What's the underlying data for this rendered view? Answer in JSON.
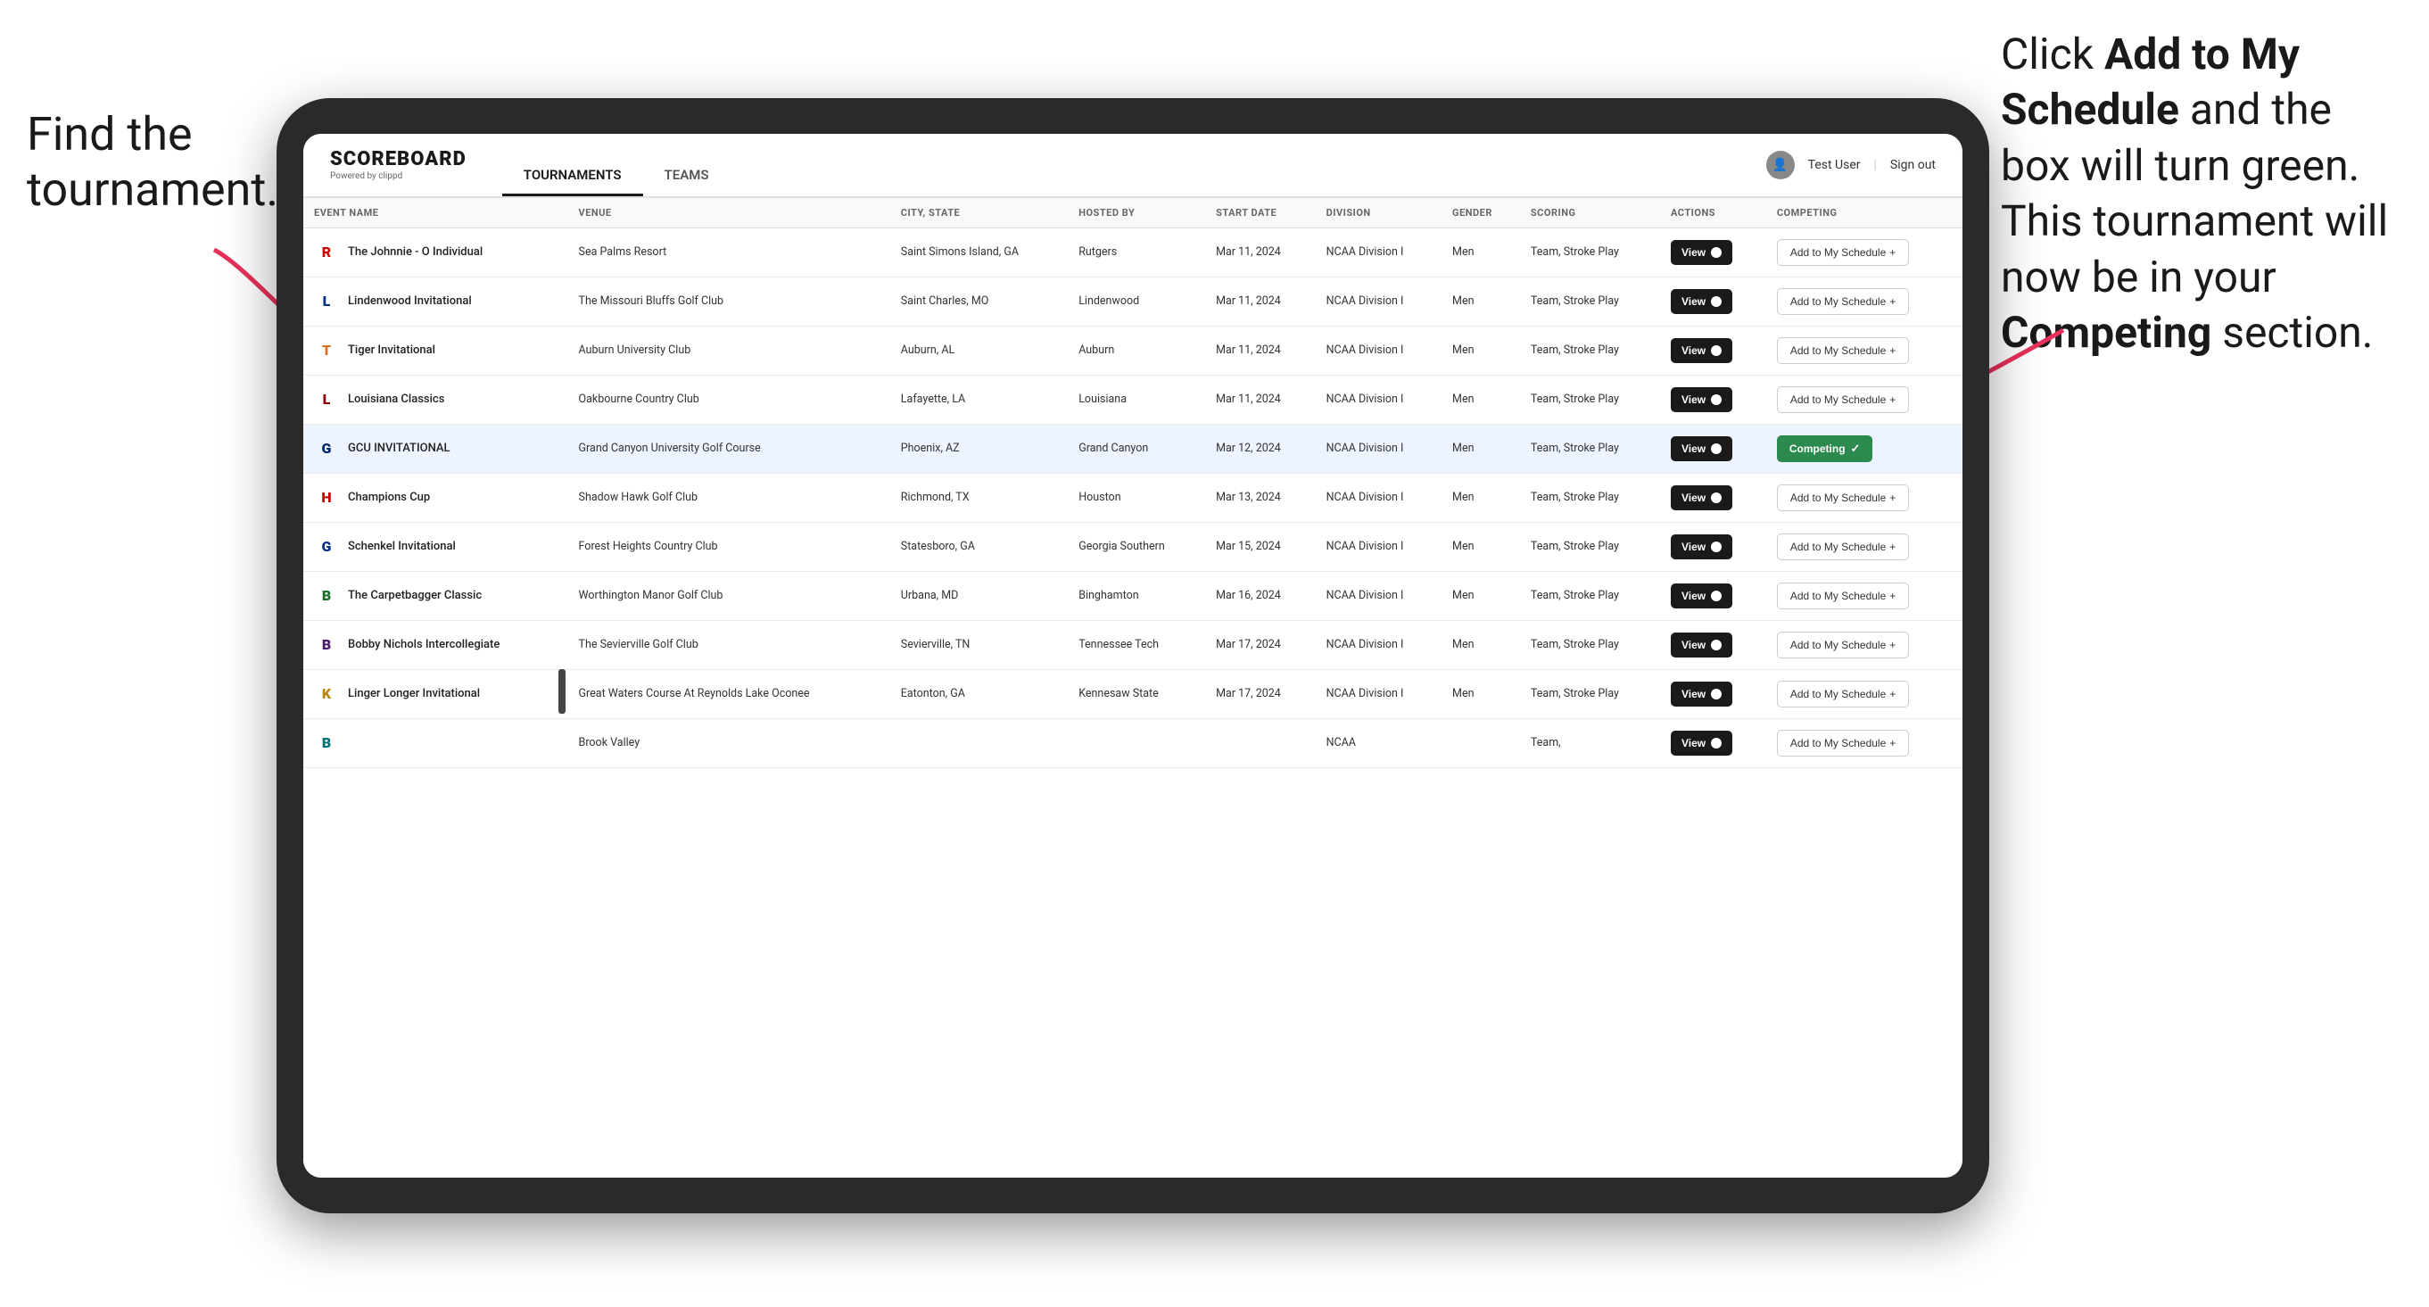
{
  "page": {
    "title": "Scoreboard App - Tournaments"
  },
  "annotation_left": {
    "text": "Find the tournament."
  },
  "annotation_right": {
    "line1": "Click ",
    "bold1": "Add to My Schedule",
    "line2": " and the box will turn green. This tournament will now be in your ",
    "bold2": "Competing",
    "line3": " section."
  },
  "header": {
    "logo": "SCOREBOARD",
    "logo_sub": "Powered by clippd",
    "nav": [
      {
        "label": "TOURNAMENTS",
        "active": true
      },
      {
        "label": "TEAMS",
        "active": false
      }
    ],
    "user_icon": "👤",
    "user_name": "Test User",
    "sign_out": "Sign out"
  },
  "table": {
    "columns": [
      {
        "id": "event_name",
        "label": "EVENT NAME"
      },
      {
        "id": "venue",
        "label": "VENUE"
      },
      {
        "id": "city_state",
        "label": "CITY, STATE"
      },
      {
        "id": "hosted_by",
        "label": "HOSTED BY"
      },
      {
        "id": "start_date",
        "label": "START DATE"
      },
      {
        "id": "division",
        "label": "DIVISION"
      },
      {
        "id": "gender",
        "label": "GENDER"
      },
      {
        "id": "scoring",
        "label": "SCORING"
      },
      {
        "id": "actions",
        "label": "ACTIONS"
      },
      {
        "id": "competing",
        "label": "COMPETING"
      }
    ],
    "rows": [
      {
        "id": 1,
        "logo": "R",
        "logo_color": "logo-red",
        "event_name": "The Johnnie - O Individual",
        "venue": "Sea Palms Resort",
        "city_state": "Saint Simons Island, GA",
        "hosted_by": "Rutgers",
        "start_date": "Mar 11, 2024",
        "division": "NCAA Division I",
        "gender": "Men",
        "scoring": "Team, Stroke Play",
        "status": "add",
        "highlighted": false
      },
      {
        "id": 2,
        "logo": "L",
        "logo_color": "logo-blue",
        "event_name": "Lindenwood Invitational",
        "venue": "The Missouri Bluffs Golf Club",
        "city_state": "Saint Charles, MO",
        "hosted_by": "Lindenwood",
        "start_date": "Mar 11, 2024",
        "division": "NCAA Division I",
        "gender": "Men",
        "scoring": "Team, Stroke Play",
        "status": "add",
        "highlighted": false
      },
      {
        "id": 3,
        "logo": "T",
        "logo_color": "logo-orange",
        "event_name": "Tiger Invitational",
        "venue": "Auburn University Club",
        "city_state": "Auburn, AL",
        "hosted_by": "Auburn",
        "start_date": "Mar 11, 2024",
        "division": "NCAA Division I",
        "gender": "Men",
        "scoring": "Team, Stroke Play",
        "status": "add",
        "highlighted": false
      },
      {
        "id": 4,
        "logo": "L",
        "logo_color": "logo-maroon",
        "event_name": "Louisiana Classics",
        "venue": "Oakbourne Country Club",
        "city_state": "Lafayette, LA",
        "hosted_by": "Louisiana",
        "start_date": "Mar 11, 2024",
        "division": "NCAA Division I",
        "gender": "Men",
        "scoring": "Team, Stroke Play",
        "status": "add",
        "highlighted": false
      },
      {
        "id": 5,
        "logo": "G",
        "logo_color": "logo-navy",
        "event_name": "GCU INVITATIONAL",
        "venue": "Grand Canyon University Golf Course",
        "city_state": "Phoenix, AZ",
        "hosted_by": "Grand Canyon",
        "start_date": "Mar 12, 2024",
        "division": "NCAA Division I",
        "gender": "Men",
        "scoring": "Team, Stroke Play",
        "status": "competing",
        "highlighted": true
      },
      {
        "id": 6,
        "logo": "H",
        "logo_color": "logo-red",
        "event_name": "Champions Cup",
        "venue": "Shadow Hawk Golf Club",
        "city_state": "Richmond, TX",
        "hosted_by": "Houston",
        "start_date": "Mar 13, 2024",
        "division": "NCAA Division I",
        "gender": "Men",
        "scoring": "Team, Stroke Play",
        "status": "add",
        "highlighted": false
      },
      {
        "id": 7,
        "logo": "G",
        "logo_color": "logo-blue",
        "event_name": "Schenkel Invitational",
        "venue": "Forest Heights Country Club",
        "city_state": "Statesboro, GA",
        "hosted_by": "Georgia Southern",
        "start_date": "Mar 15, 2024",
        "division": "NCAA Division I",
        "gender": "Men",
        "scoring": "Team, Stroke Play",
        "status": "add",
        "highlighted": false
      },
      {
        "id": 8,
        "logo": "B",
        "logo_color": "logo-green",
        "event_name": "The Carpetbagger Classic",
        "venue": "Worthington Manor Golf Club",
        "city_state": "Urbana, MD",
        "hosted_by": "Binghamton",
        "start_date": "Mar 16, 2024",
        "division": "NCAA Division I",
        "gender": "Men",
        "scoring": "Team, Stroke Play",
        "status": "add",
        "highlighted": false
      },
      {
        "id": 9,
        "logo": "B",
        "logo_color": "logo-purple",
        "event_name": "Bobby Nichols Intercollegiate",
        "venue": "The Sevierville Golf Club",
        "city_state": "Sevierville, TN",
        "hosted_by": "Tennessee Tech",
        "start_date": "Mar 17, 2024",
        "division": "NCAA Division I",
        "gender": "Men",
        "scoring": "Team, Stroke Play",
        "status": "add",
        "highlighted": false
      },
      {
        "id": 10,
        "logo": "K",
        "logo_color": "logo-gold",
        "event_name": "Linger Longer Invitational",
        "venue": "Great Waters Course At Reynolds Lake Oconee",
        "city_state": "Eatonton, GA",
        "hosted_by": "Kennesaw State",
        "start_date": "Mar 17, 2024",
        "division": "NCAA Division I",
        "gender": "Men",
        "scoring": "Team, Stroke Play",
        "status": "add",
        "highlighted": false
      },
      {
        "id": 11,
        "logo": "B",
        "logo_color": "logo-teal",
        "event_name": "",
        "venue": "Brook Valley",
        "city_state": "",
        "hosted_by": "",
        "start_date": "",
        "division": "NCAA",
        "gender": "",
        "scoring": "Team,",
        "status": "add",
        "highlighted": false
      }
    ]
  },
  "buttons": {
    "view": "View",
    "add_to_schedule": "Add to My Schedule",
    "add_schedule_plus": "+",
    "competing": "Competing",
    "competing_check": "✓"
  }
}
